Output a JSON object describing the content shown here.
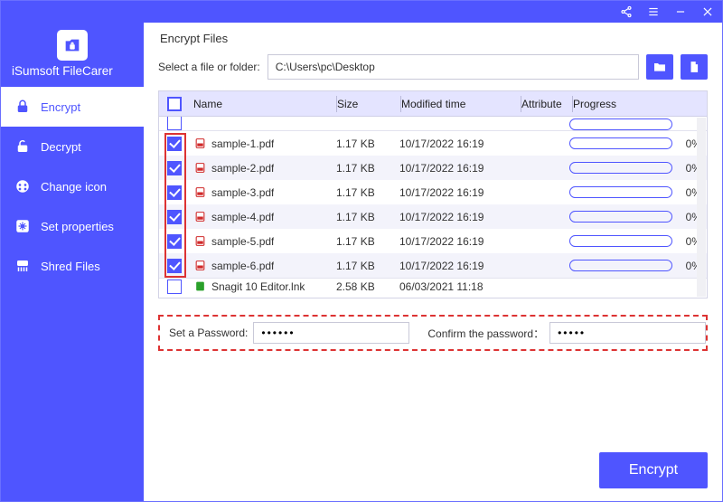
{
  "app_name": "iSumsoft FileCarer",
  "sidebar": {
    "items": [
      {
        "label": "Encrypt"
      },
      {
        "label": "Decrypt"
      },
      {
        "label": "Change icon"
      },
      {
        "label": "Set properties"
      },
      {
        "label": "Shred Files"
      }
    ]
  },
  "main": {
    "title": "Encrypt Files",
    "path_label": "Select a file or folder:",
    "path_value": "C:\\Users\\pc\\Desktop",
    "columns": {
      "name": "Name",
      "size": "Size",
      "mtime": "Modified time",
      "attr": "Attribute",
      "progress": "Progress"
    },
    "rows": [
      {
        "checked": true,
        "icon": "pdf",
        "name": "sample-1.pdf",
        "size": "1.17 KB",
        "mtime": "10/17/2022 16:19",
        "attr": "",
        "pct": "0%"
      },
      {
        "checked": true,
        "icon": "pdf",
        "name": "sample-2.pdf",
        "size": "1.17 KB",
        "mtime": "10/17/2022 16:19",
        "attr": "",
        "pct": "0%"
      },
      {
        "checked": true,
        "icon": "pdf",
        "name": "sample-3.pdf",
        "size": "1.17 KB",
        "mtime": "10/17/2022 16:19",
        "attr": "",
        "pct": "0%"
      },
      {
        "checked": true,
        "icon": "pdf",
        "name": "sample-4.pdf",
        "size": "1.17 KB",
        "mtime": "10/17/2022 16:19",
        "attr": "",
        "pct": "0%"
      },
      {
        "checked": true,
        "icon": "pdf",
        "name": "sample-5.pdf",
        "size": "1.17 KB",
        "mtime": "10/17/2022 16:19",
        "attr": "",
        "pct": "0%"
      },
      {
        "checked": true,
        "icon": "pdf",
        "name": "sample-6.pdf",
        "size": "1.17 KB",
        "mtime": "10/17/2022 16:19",
        "attr": "",
        "pct": "0%"
      }
    ],
    "partial_row": {
      "checked": false,
      "icon": "lnk",
      "name": "Snagit 10 Editor.lnk",
      "size": "2.58 KB",
      "mtime": "06/03/2021 11:18"
    },
    "password": {
      "set_label": "Set a Password:",
      "set_value": "••••••",
      "confirm_label": "Confirm the password：",
      "confirm_value": "•••••"
    },
    "action_label": "Encrypt"
  }
}
